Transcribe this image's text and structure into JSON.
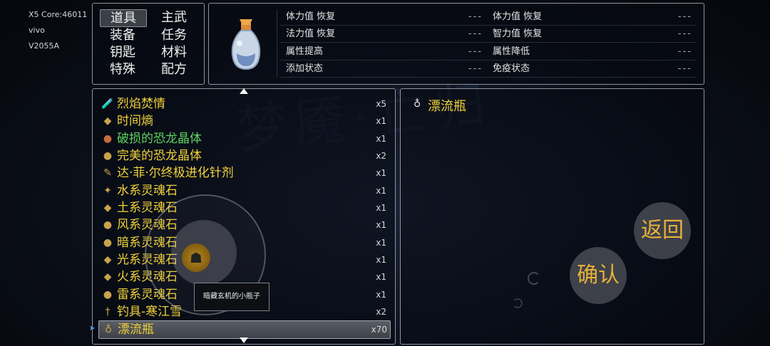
{
  "watermark": "梦魇·亡归",
  "device": {
    "line1": "X5 Core:46011",
    "line2": "vivo",
    "line3": "V2055A"
  },
  "categories": [
    "道具",
    "主武",
    "装备",
    "任务",
    "钥匙",
    "材料",
    "特殊",
    "配方"
  ],
  "stats": {
    "left": [
      {
        "label": "体力值  恢复",
        "value": "---"
      },
      {
        "label": "法力值  恢复",
        "value": "---"
      },
      {
        "label": "属性提高",
        "value": "---"
      },
      {
        "label": "添加状态",
        "value": "---"
      }
    ],
    "right": [
      {
        "label": "体力值  恢复",
        "value": "---"
      },
      {
        "label": "智力值  恢复",
        "value": "---"
      },
      {
        "label": "属性降低",
        "value": "---"
      },
      {
        "label": "免疫状态",
        "value": "---"
      }
    ]
  },
  "items": [
    {
      "name": "烈焰焚情",
      "qty": "x5",
      "icon": "red-potion-icon",
      "glyph": "🧪",
      "color": "#f0d23a"
    },
    {
      "name": "时间熵",
      "qty": "x1",
      "icon": "dark-crystal-icon",
      "glyph": "◆",
      "color": "#f0d23a"
    },
    {
      "name": "破损的恐龙晶体",
      "qty": "x1",
      "icon": "cracked-orb-icon",
      "glyph": "●",
      "color": "#5fd35f"
    },
    {
      "name": "完美的恐龙晶体",
      "qty": "x2",
      "icon": "golden-orb-icon",
      "glyph": "●",
      "color": "#f0d23a"
    },
    {
      "name": "达·菲·尔终极进化针剂",
      "qty": "x1",
      "icon": "syringe-icon",
      "glyph": "✎",
      "color": "#f0d23a"
    },
    {
      "name": "水系灵魂石",
      "qty": "x1",
      "icon": "water-stone-icon",
      "glyph": "✦",
      "color": "#f0d23a"
    },
    {
      "name": "土系灵魂石",
      "qty": "x1",
      "icon": "earth-stone-icon",
      "glyph": "◆",
      "color": "#f0d23a"
    },
    {
      "name": "风系灵魂石",
      "qty": "x1",
      "icon": "wind-stone-icon",
      "glyph": "●",
      "color": "#f0d23a"
    },
    {
      "name": "暗系灵魂石",
      "qty": "x1",
      "icon": "dark-stone-icon",
      "glyph": "●",
      "color": "#f0d23a"
    },
    {
      "name": "光系灵魂石",
      "qty": "x1",
      "icon": "light-stone-icon",
      "glyph": "◆",
      "color": "#f0d23a"
    },
    {
      "name": "火系灵魂石",
      "qty": "x1",
      "icon": "fire-stone-icon",
      "glyph": "◆",
      "color": "#f0d23a"
    },
    {
      "name": "雷系灵魂石",
      "qty": "x1",
      "icon": "thunder-stone-icon",
      "glyph": "●",
      "color": "#f0d23a"
    },
    {
      "name": "钓具-寒江雪",
      "qty": "x2",
      "icon": "fishing-rod-icon",
      "glyph": "†",
      "color": "#f0d23a"
    },
    {
      "name": "漂流瓶",
      "qty": "x70",
      "icon": "drift-bottle-icon",
      "glyph": "♁",
      "color": "#f0d23a"
    }
  ],
  "detail": {
    "title": "漂流瓶"
  },
  "tooltip": "暗藏玄机的小瓶子",
  "buttons": {
    "back": "返回",
    "confirm": "确认"
  }
}
